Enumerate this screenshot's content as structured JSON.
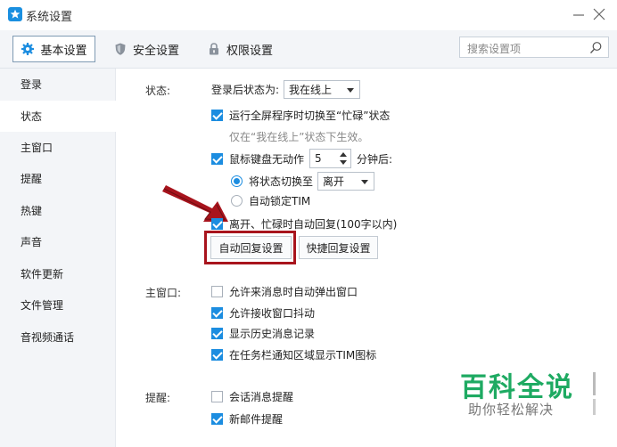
{
  "window": {
    "title": "系统设置",
    "minimize_icon": "minimize-icon",
    "close_icon": "close-icon"
  },
  "tabs": [
    {
      "label": "基本设置",
      "icon": "gear-icon",
      "active": true
    },
    {
      "label": "安全设置",
      "icon": "shield-icon",
      "active": false
    },
    {
      "label": "权限设置",
      "icon": "lock-icon",
      "active": false
    }
  ],
  "search": {
    "placeholder": "搜索设置项",
    "icon": "search-icon"
  },
  "sidebar": {
    "items": [
      {
        "label": "登录",
        "active": false
      },
      {
        "label": "状态",
        "active": true
      },
      {
        "label": "主窗口",
        "active": false
      },
      {
        "label": "提醒",
        "active": false
      },
      {
        "label": "热键",
        "active": false
      },
      {
        "label": "声音",
        "active": false
      },
      {
        "label": "软件更新",
        "active": false
      },
      {
        "label": "文件管理",
        "active": false
      },
      {
        "label": "音视频通话",
        "active": false
      }
    ]
  },
  "status_section": {
    "label": "状态:",
    "login_status_label": "登录后状态为:",
    "login_status_value": "我在线上",
    "fullscreen_busy": {
      "label": "运行全屏程序时切换至“忙碌”状态",
      "checked": true
    },
    "fullscreen_note": "仅在“我在线上”状态下生效。",
    "idle": {
      "label": "鼠标键盘无动作",
      "checked": true,
      "minutes": "5",
      "suffix": "分钟后:"
    },
    "switch_to": {
      "label": "将状态切换至",
      "selected": true,
      "value": "离开"
    },
    "auto_lock": {
      "label": "自动锁定TIM",
      "selected": false
    },
    "auto_reply": {
      "label": "离开、忙碌时自动回复(100字以内)",
      "checked": true
    },
    "auto_reply_button": "自动回复设置",
    "quick_reply_button": "快捷回复设置"
  },
  "main_window_section": {
    "label": "主窗口:",
    "options": [
      {
        "label": "允许来消息时自动弹出窗口",
        "checked": false
      },
      {
        "label": "允许接收窗口抖动",
        "checked": true
      },
      {
        "label": "显示历史消息记录",
        "checked": true
      },
      {
        "label": "在任务栏通知区域显示TIM图标",
        "checked": true
      }
    ]
  },
  "reminder_section": {
    "label": "提醒:",
    "options": [
      {
        "label": "会话消息提醒",
        "checked": false
      },
      {
        "label": "新邮件提醒",
        "checked": true
      }
    ]
  },
  "watermark": {
    "title": "百科全说",
    "subtitle": "助你轻松解决"
  },
  "colors": {
    "accent": "#1c8de0",
    "highlight": "#a8141d",
    "arrow": "#a8141d",
    "watermark": "#1eaa62"
  }
}
